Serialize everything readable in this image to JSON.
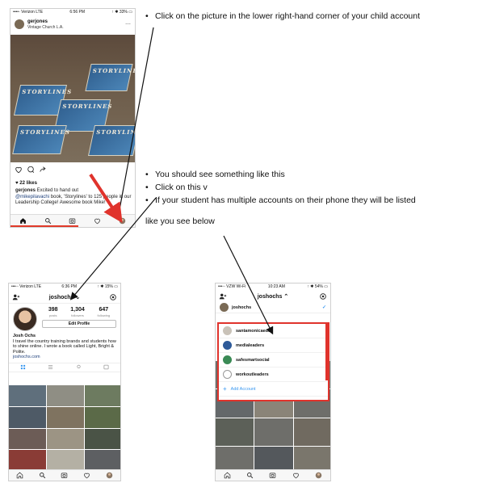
{
  "instructions": {
    "step1": "Click on the picture in the lower right-hand corner of your child account",
    "step2": "You should see something like this",
    "step3": "Click on this v",
    "step4": "If your student has multiple accounts  on their phone they will be listed",
    "step4_cont": "like you see below"
  },
  "phone1": {
    "status": {
      "carrier": "••••◦ Verizon  LTE",
      "time": "6:56 PM",
      "battery": "↑ ✱ 33% ▭"
    },
    "post_user": "gerjones",
    "post_location": "Vintage Church L.A.",
    "book_title": "STORYLINES",
    "likes": "♥ 22 likes",
    "caption_user": "gerjones",
    "caption_text_1": " Excited to hand out",
    "caption_mention": "@mikepilavachi",
    "caption_text_2": " book, 'Storylines' to 125 people in our Leadership College! Awesome book Mike!"
  },
  "phone2": {
    "status": {
      "carrier": "•••◦◦ Verizon  LTE",
      "time": "6:36 PM",
      "battery": "↑ ✱ 15% ▭"
    },
    "username": "joshochs ⌄",
    "posts_num": "398",
    "posts_label": "posts",
    "followers_num": "1,304",
    "followers_label": "followers",
    "following_num": "647",
    "following_label": "following",
    "edit_profile": "Edit Profile",
    "bio_name": "Josh Ochs",
    "bio_text": "I travel the country training brands and students how to shine online. I wrote a book called Light, Bright & Polite.",
    "bio_link": "joshochs.com"
  },
  "phone3": {
    "status": {
      "carrier": "•••◦◦ VZW Wi-Fi",
      "time": "10:23 AM",
      "battery": "↑ ✱ 54% ▭"
    },
    "username": "joshochs ⌃",
    "current_account": "joshochs",
    "accounts": [
      "santamonicaedu",
      "medialeaders",
      "safesmartsocial",
      "workoutleaders"
    ],
    "add_account": "Add Account"
  },
  "colors": {
    "accent_red": "#e0332c",
    "link_blue": "#1d3f7a",
    "ig_blue": "#3897f0"
  }
}
